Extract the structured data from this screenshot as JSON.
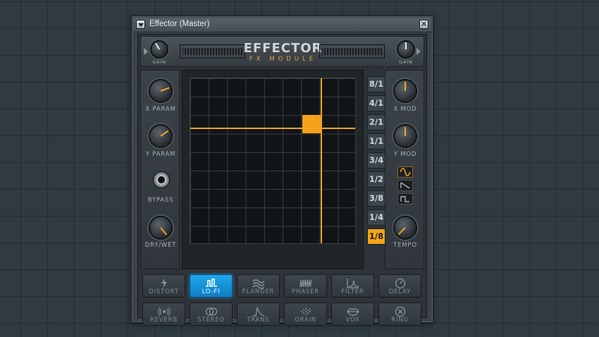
{
  "window": {
    "title": "Effector (Master)",
    "close_glyph": "✕"
  },
  "header": {
    "title": "EFFECTOR",
    "subtitle": "FX MODULE",
    "gain_left_label": "GAIN",
    "gain_right_label": "GAIN"
  },
  "left_controls": {
    "x_param": "X PARAM",
    "y_param": "Y PARAM",
    "bypass": "BYPASS",
    "dry_wet": "DRY/WET"
  },
  "right_controls": {
    "x_mod": "X MOD",
    "y_mod": "Y MOD",
    "tempo": "TEMPO",
    "shapes": [
      "sine-wave-icon",
      "saw-wave-icon",
      "square-wave-icon"
    ],
    "active_shape": "sine"
  },
  "rates": [
    "8/1",
    "4/1",
    "2/1",
    "1/1",
    "3/4",
    "1/2",
    "3/8",
    "1/4",
    "1/8"
  ],
  "active_rate": "1/8",
  "effects": [
    {
      "label": "DISTORT",
      "icon": "lightning-icon",
      "active": false
    },
    {
      "label": "LO-FI",
      "icon": "square-pulse-icon",
      "active": true
    },
    {
      "label": "FLANGER",
      "icon": "waves-icon",
      "active": false
    },
    {
      "label": "PHASER",
      "icon": "comb-icon",
      "active": false
    },
    {
      "label": "FILTER",
      "icon": "filter-curve-icon",
      "active": false
    },
    {
      "label": "DELAY",
      "icon": "clock-icon",
      "active": false
    },
    {
      "label": "REVERB",
      "icon": "radiate-icon",
      "active": false
    },
    {
      "label": "STEREO",
      "icon": "two-circles-icon",
      "active": false
    },
    {
      "label": "TRANS",
      "icon": "envelope-icon",
      "active": false
    },
    {
      "label": "GRAIN",
      "icon": "dots-icon",
      "active": false
    },
    {
      "label": "VOX",
      "icon": "lips-icon",
      "active": false
    },
    {
      "label": "RING",
      "icon": "ring-x-icon",
      "active": false
    }
  ],
  "colors": {
    "accent": "#f3a31a",
    "active_fx": "#1fa6ea"
  }
}
